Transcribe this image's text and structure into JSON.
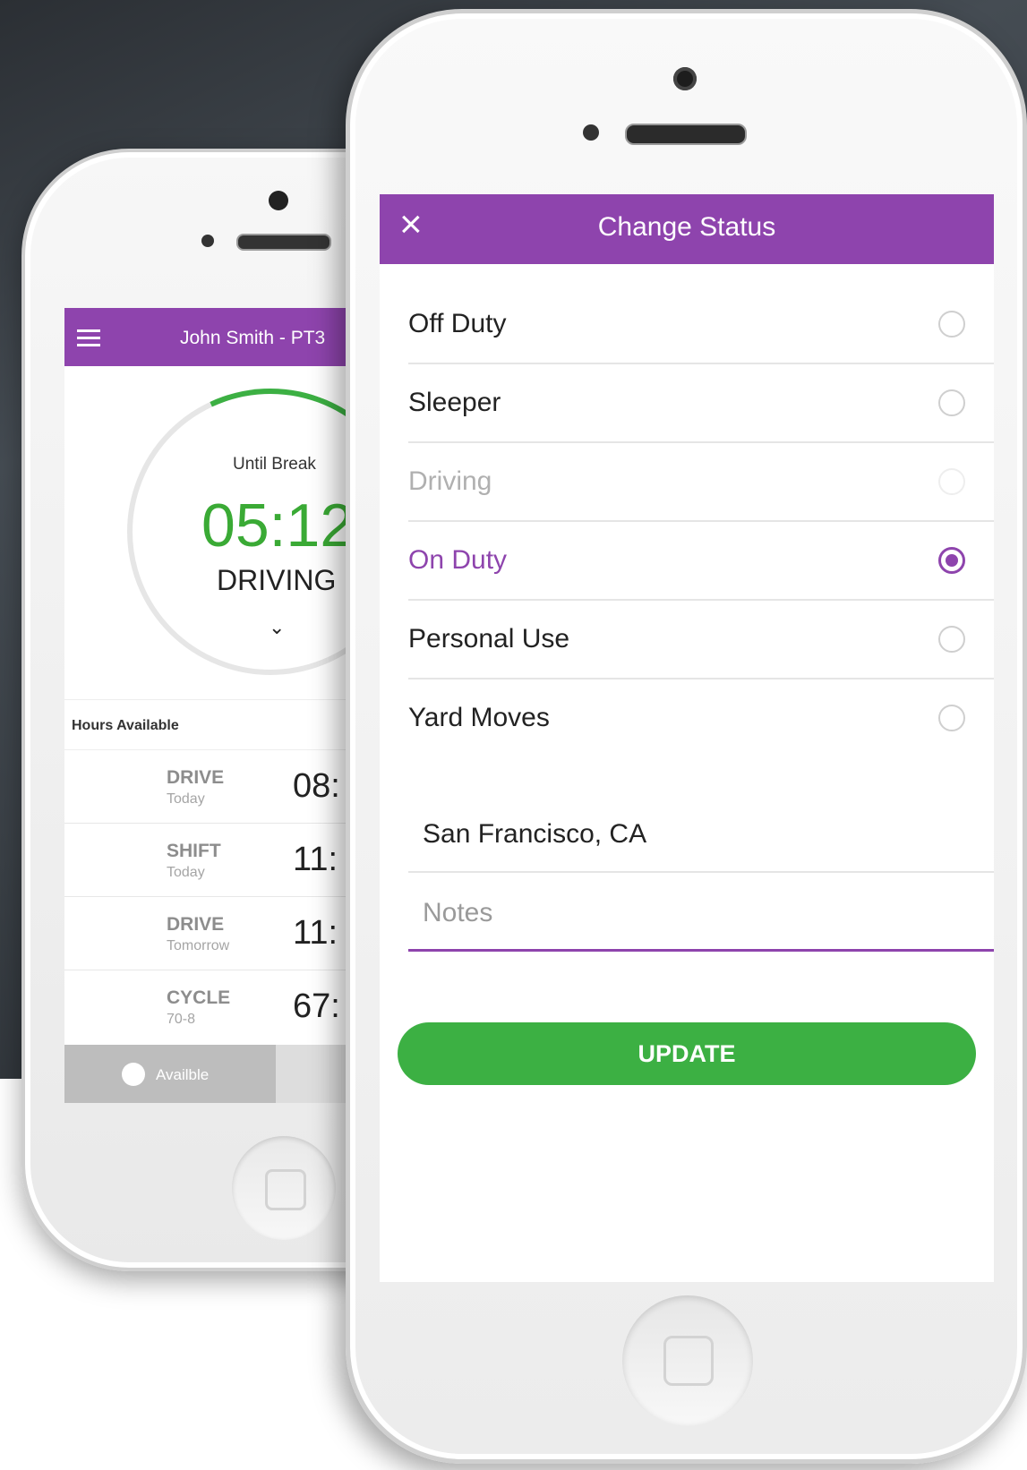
{
  "back_phone": {
    "header_title": "John Smith - PT3",
    "until_label": "Until Break",
    "timer": "05:12",
    "status": "DRIVING",
    "chevron": "⌄",
    "hours_label": "Hours Available",
    "rows": [
      {
        "key": "DRIVE",
        "sub": "Today",
        "value": "08:"
      },
      {
        "key": "SHIFT",
        "sub": "Today",
        "value": "11:"
      },
      {
        "key": "DRIVE",
        "sub": "Tomorrow",
        "value": "11:"
      },
      {
        "key": "CYCLE",
        "sub": "70-8",
        "value": "67:"
      }
    ],
    "footer_label": "Availble"
  },
  "front_phone": {
    "header_title": "Change Status",
    "close_icon": "×",
    "options": [
      {
        "label": "Off Duty",
        "state": "normal"
      },
      {
        "label": "Sleeper",
        "state": "normal"
      },
      {
        "label": "Driving",
        "state": "disabled"
      },
      {
        "label": "On Duty",
        "state": "selected"
      },
      {
        "label": "Personal Use",
        "state": "normal"
      },
      {
        "label": "Yard Moves",
        "state": "normal"
      }
    ],
    "location_value": "San Francisco, CA",
    "notes_placeholder": "Notes",
    "update_label": "UPDATE"
  },
  "colors": {
    "accent_purple": "#8e44ad",
    "accent_green": "#3cb043"
  }
}
